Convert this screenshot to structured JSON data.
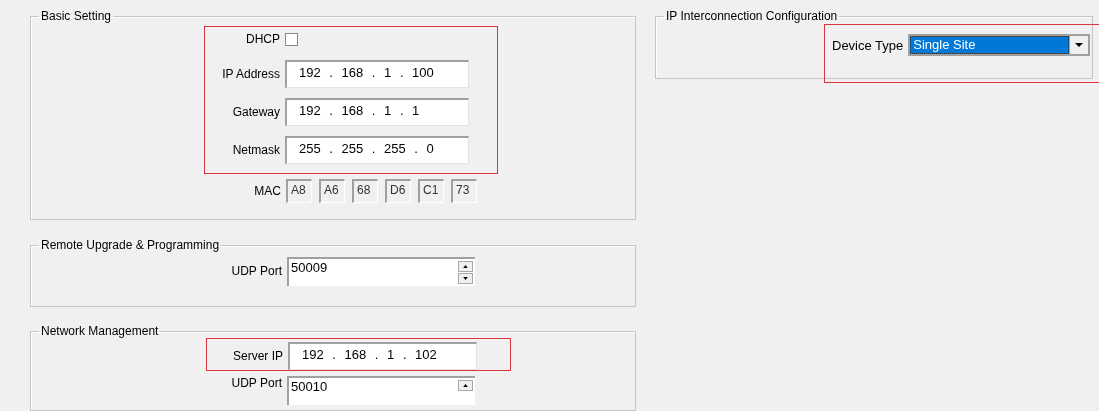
{
  "basic_setting": {
    "title": "Basic Setting",
    "dhcp": {
      "label": "DHCP",
      "checked": false
    },
    "fields": [
      {
        "label": "IP Address",
        "value": "192 . 168 . 1 . 100"
      },
      {
        "label": "Gateway",
        "value": "192 . 168 . 1 . 1"
      },
      {
        "label": "Netmask",
        "value": "255 . 255 . 255 . 0"
      }
    ],
    "mac": {
      "label": "MAC",
      "octets": [
        "A8",
        "A6",
        "68",
        "D6",
        "C1",
        "73"
      ]
    }
  },
  "remote_upgrade": {
    "title": "Remote Upgrade & Programming",
    "udp_port": {
      "label": "UDP Port",
      "value": "50009"
    }
  },
  "network_management": {
    "title": "Network Management",
    "server_ip": {
      "label": "Server IP",
      "value": "192 . 168 . 1 . 102"
    },
    "udp_port": {
      "label": "UDP Port",
      "value": "50010"
    }
  },
  "ip_interconnection": {
    "title": "IP Interconnection Configuration",
    "device_type": {
      "label": "Device Type",
      "value": "Single Site"
    }
  }
}
